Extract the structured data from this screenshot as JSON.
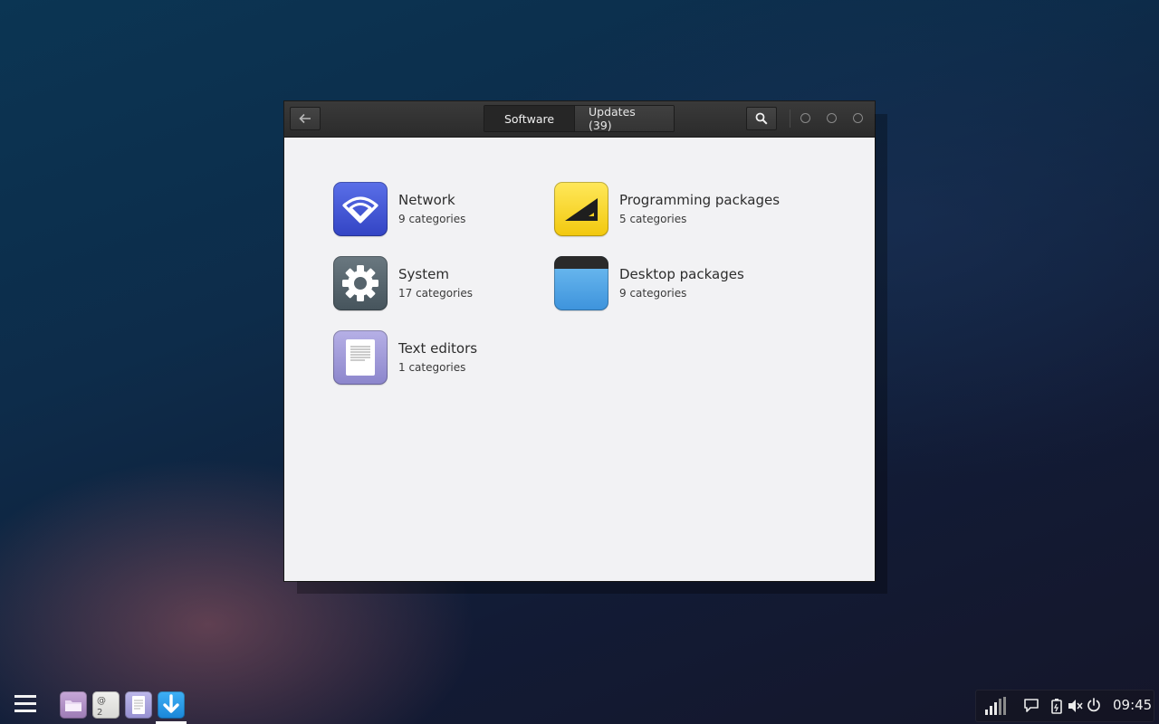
{
  "window": {
    "tabs": [
      {
        "label": "Software",
        "active": true
      },
      {
        "label": "Updates (39)",
        "active": false
      }
    ],
    "back_icon": "arrow-left-icon",
    "search_icon": "search-icon"
  },
  "categories": [
    {
      "title": "Network",
      "subtitle": "9 categories",
      "icon": "wifi-icon",
      "color": "#4557d6"
    },
    {
      "title": "Programming packages",
      "subtitle": "5 categories",
      "icon": "triangle-ruler-icon",
      "color": "#f5d020"
    },
    {
      "title": "System",
      "subtitle": "17 categories",
      "icon": "gear-icon",
      "color": "#56646c"
    },
    {
      "title": "Desktop packages",
      "subtitle": "9 categories",
      "icon": "window-icon",
      "color": "#4aa3e6"
    },
    {
      "title": "Text editors",
      "subtitle": "1 categories",
      "icon": "document-icon",
      "color": "#a39ddc"
    }
  ],
  "dock": [
    {
      "name": "file-manager",
      "icon": "folder-icon"
    },
    {
      "name": "email-client",
      "icon": "at-sign-icon",
      "label": "@\n2"
    },
    {
      "name": "text-editor",
      "icon": "document-icon"
    },
    {
      "name": "software-center",
      "icon": "download-arrow-icon",
      "active": true
    }
  ],
  "tray": {
    "clock": "09:45",
    "icons": [
      "signal-icon",
      "chat-icon",
      "battery-icon",
      "volume-muted-icon",
      "power-icon"
    ]
  }
}
